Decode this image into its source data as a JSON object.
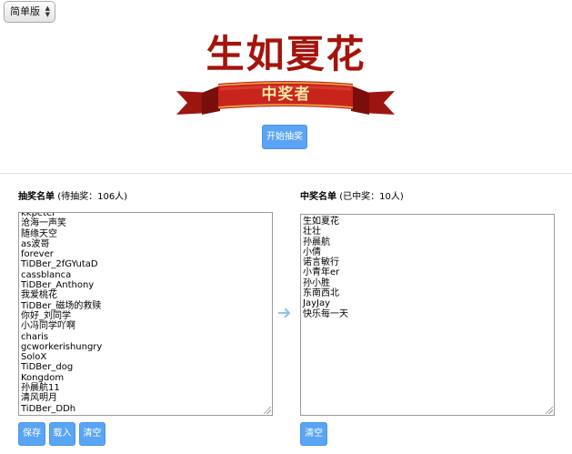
{
  "mode_select": {
    "selected": "简单版"
  },
  "title": "生如夏花",
  "banner_text": "中奖者",
  "start_button": "开始抽奖",
  "pool": {
    "label": "抽奖名单",
    "count_text": "(待抽奖：106人)",
    "names": [
      "kkpeter",
      "沧海一声笑",
      "随缘天空",
      "as波哥",
      "forever",
      "TiDBer_2fGYutaD",
      "cassblanca",
      "TiDBer_Anthony",
      "我爱桃花",
      "TiDBer_磁场的救赎",
      "你好_刘同学",
      "小冯同学吖啊",
      "charis",
      "gcworkerishungry",
      "SoloX",
      "TiDBer_dog",
      "Kongdom",
      "孙晨航11",
      "清风明月",
      "TiDBer_DDh"
    ],
    "buttons": {
      "save": "保存",
      "load": "载入",
      "clear": "清空"
    }
  },
  "winners": {
    "label": "中奖名单",
    "count_text": "(已中奖：10人)",
    "names": [
      "生如夏花",
      "壮壮",
      "孙晨航",
      "小倩",
      "诺言敏行",
      "小青年er",
      "孙小胜",
      "东南西北",
      "JayJay",
      "快乐每一天"
    ],
    "buttons": {
      "clear": "清空"
    }
  },
  "colors": {
    "title": "#a4140c",
    "ribbon": "#c8241b",
    "button": "#5aa4f4",
    "arrow": "#8ec3ef"
  },
  "icons": {
    "transfer": "arrow-right-icon"
  }
}
